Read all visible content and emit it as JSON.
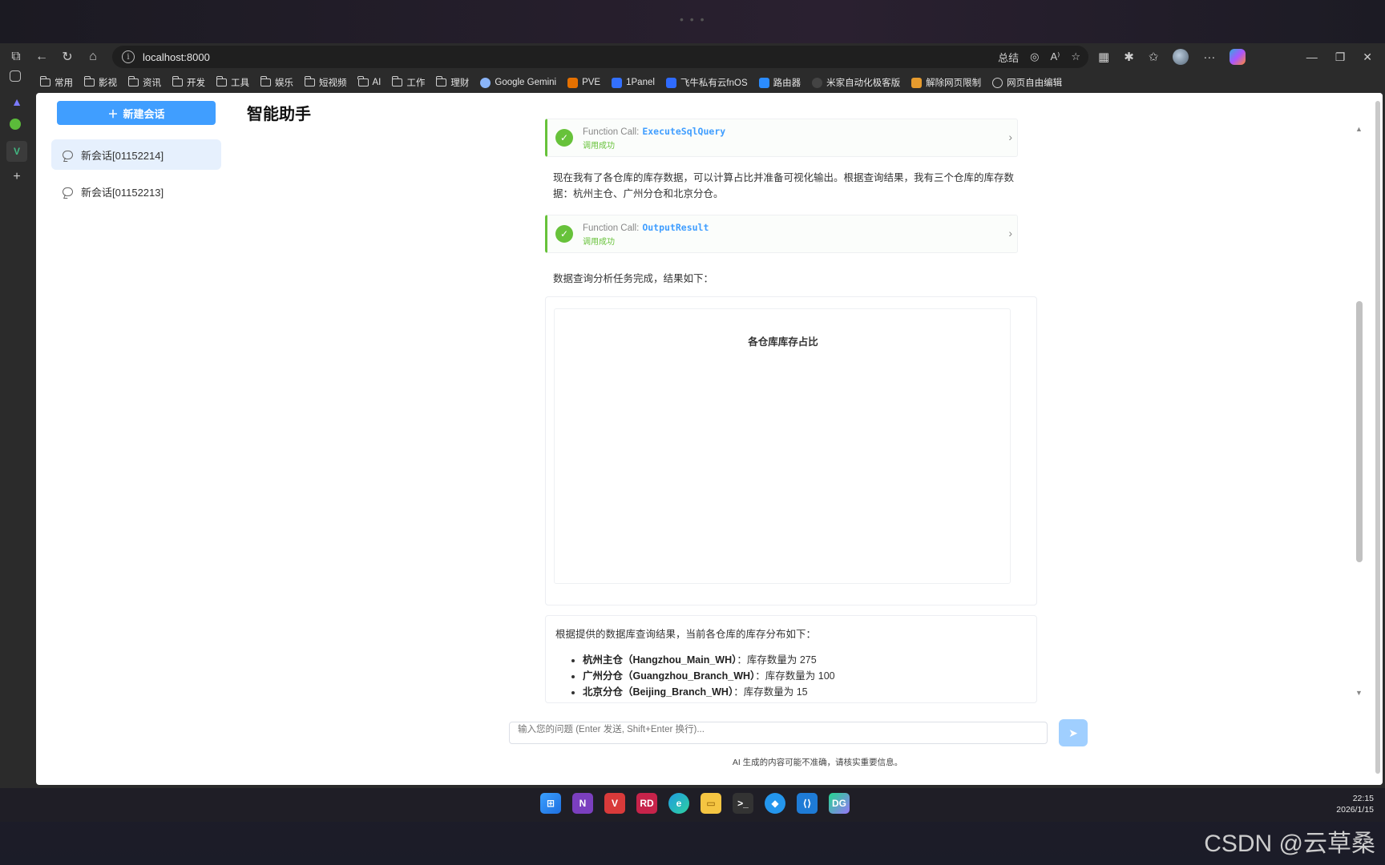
{
  "window": {
    "url": "localhost:8000",
    "summary_label": "总结"
  },
  "bookmarks": [
    {
      "label": "常用",
      "icon": "folder-icon"
    },
    {
      "label": "影视",
      "icon": "folder-icon"
    },
    {
      "label": "资讯",
      "icon": "folder-icon"
    },
    {
      "label": "开发",
      "icon": "folder-icon"
    },
    {
      "label": "工具",
      "icon": "folder-icon"
    },
    {
      "label": "娱乐",
      "icon": "folder-icon"
    },
    {
      "label": "短视频",
      "icon": "folder-icon"
    },
    {
      "label": "AI",
      "icon": "folder-icon"
    },
    {
      "label": "工作",
      "icon": "folder-icon"
    },
    {
      "label": "理财",
      "icon": "folder-icon"
    },
    {
      "label": "Google Gemini",
      "icon": "gemini-icon",
      "color": "#8ab4f8"
    },
    {
      "label": "PVE",
      "icon": "proxmox-icon",
      "color": "#e57000"
    },
    {
      "label": "1Panel",
      "icon": "1panel-icon",
      "color": "#3370ff"
    },
    {
      "label": "飞牛私有云fnOS",
      "icon": "fnos-icon",
      "color": "#2f6bff"
    },
    {
      "label": "路由器",
      "icon": "wifi-icon",
      "color": "#2b8cff"
    },
    {
      "label": "米家自动化极客版",
      "icon": "mijia-icon",
      "color": "#444444"
    },
    {
      "label": "解除网页限制",
      "icon": "unlock-icon",
      "color": "#e69b2e"
    },
    {
      "label": "网页自由编辑",
      "icon": "globe-icon",
      "color": "#cccccc"
    }
  ],
  "sidebar": {
    "new_chat_label": "新建会话",
    "sessions": [
      {
        "label": "新会话[01152214]",
        "active": true
      },
      {
        "label": "新会话[01152213]",
        "active": false
      }
    ]
  },
  "header": {
    "title": "智能助手"
  },
  "chat": {
    "function_calls": [
      {
        "prefix": "Function Call:",
        "name": "ExecuteSqlQuery",
        "status": "调用成功"
      },
      {
        "prefix": "Function Call:",
        "name": "OutputResult",
        "status": "调用成功"
      }
    ],
    "message_1": "现在我有了各仓库的库存数据，可以计算占比并准备可视化输出。根据查询结果，我有三个仓库的库存数据：杭州主仓、广州分仓和北京分仓。",
    "message_2": "数据查询分析任务完成，结果如下：",
    "chart_title": "各仓库库存占比",
    "answer_intro": "根据提供的数据库查询结果，当前各仓库的库存分布如下：",
    "answer_items": [
      {
        "name": "杭州主仓（Hangzhou_Main_WH）",
        "value": "：库存数量为 275"
      },
      {
        "name": "广州分仓（Guangzhou_Branch_WH）",
        "value": "：库存数量为 100"
      },
      {
        "name": "北京分仓（Beijing_Branch_WH）",
        "value": "：库存数量为 15"
      }
    ]
  },
  "input": {
    "placeholder": "输入您的问题 (Enter 发送, Shift+Enter 换行)...",
    "disclaimer": "AI 生成的内容可能不准确，请核实重要信息。"
  },
  "taskbar": {
    "time": "22:15",
    "date": "2026/1/15"
  },
  "watermark": "CSDN @云草桑",
  "colors": {
    "accent": "#409eff",
    "success": "#67c23a",
    "active_session_bg": "#e6f0fd"
  }
}
